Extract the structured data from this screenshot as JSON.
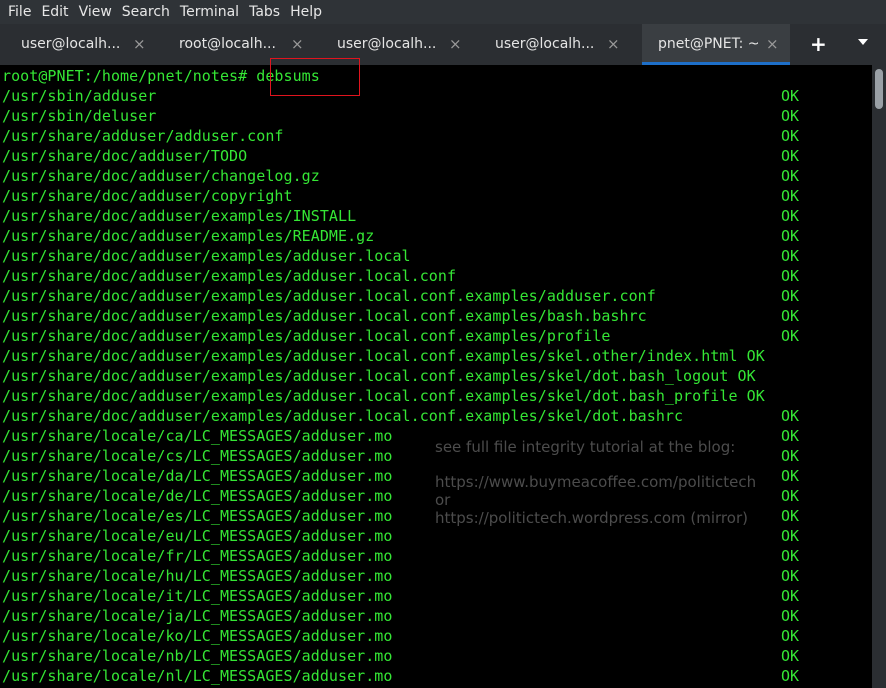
{
  "menu": [
    "File",
    "Edit",
    "View",
    "Search",
    "Terminal",
    "Tabs",
    "Help"
  ],
  "tabs": [
    {
      "label": "user@localh...",
      "close": "×"
    },
    {
      "label": "root@localh...",
      "close": "×"
    },
    {
      "label": "user@localh...",
      "close": "×"
    },
    {
      "label": "user@localh...",
      "close": "×"
    },
    {
      "label": "pnet@PNET: ~",
      "close": "×",
      "active": true
    }
  ],
  "add_tab": "+",
  "prompt": {
    "text": "root@PNET:/home/pnet/notes# ",
    "command": "debsums"
  },
  "lines": [
    {
      "path": "/usr/sbin/adduser",
      "status": "OK"
    },
    {
      "path": "/usr/sbin/deluser",
      "status": "OK"
    },
    {
      "path": "/usr/share/adduser/adduser.conf",
      "status": "OK"
    },
    {
      "path": "/usr/share/doc/adduser/TODO",
      "status": "OK"
    },
    {
      "path": "/usr/share/doc/adduser/changelog.gz",
      "status": "OK"
    },
    {
      "path": "/usr/share/doc/adduser/copyright",
      "status": "OK"
    },
    {
      "path": "/usr/share/doc/adduser/examples/INSTALL",
      "status": "OK"
    },
    {
      "path": "/usr/share/doc/adduser/examples/README.gz",
      "status": "OK"
    },
    {
      "path": "/usr/share/doc/adduser/examples/adduser.local",
      "status": "OK"
    },
    {
      "path": "/usr/share/doc/adduser/examples/adduser.local.conf",
      "status": "OK"
    },
    {
      "path": "/usr/share/doc/adduser/examples/adduser.local.conf.examples/adduser.conf",
      "status": "OK"
    },
    {
      "path": "/usr/share/doc/adduser/examples/adduser.local.conf.examples/bash.bashrc",
      "status": "OK"
    },
    {
      "path": "/usr/share/doc/adduser/examples/adduser.local.conf.examples/profile",
      "status": "OK"
    },
    {
      "path": "/usr/share/doc/adduser/examples/adduser.local.conf.examples/skel.other/index.html OK",
      "status": ""
    },
    {
      "path": "/usr/share/doc/adduser/examples/adduser.local.conf.examples/skel/dot.bash_logout OK",
      "status": ""
    },
    {
      "path": "/usr/share/doc/adduser/examples/adduser.local.conf.examples/skel/dot.bash_profile OK",
      "status": ""
    },
    {
      "path": "/usr/share/doc/adduser/examples/adduser.local.conf.examples/skel/dot.bashrc",
      "status": "OK"
    },
    {
      "path": "/usr/share/locale/ca/LC_MESSAGES/adduser.mo",
      "status": "OK"
    },
    {
      "path": "/usr/share/locale/cs/LC_MESSAGES/adduser.mo",
      "status": "OK"
    },
    {
      "path": "/usr/share/locale/da/LC_MESSAGES/adduser.mo",
      "status": "OK"
    },
    {
      "path": "/usr/share/locale/de/LC_MESSAGES/adduser.mo",
      "status": "OK"
    },
    {
      "path": "/usr/share/locale/es/LC_MESSAGES/adduser.mo",
      "status": "OK"
    },
    {
      "path": "/usr/share/locale/eu/LC_MESSAGES/adduser.mo",
      "status": "OK"
    },
    {
      "path": "/usr/share/locale/fr/LC_MESSAGES/adduser.mo",
      "status": "OK"
    },
    {
      "path": "/usr/share/locale/hu/LC_MESSAGES/adduser.mo",
      "status": "OK"
    },
    {
      "path": "/usr/share/locale/it/LC_MESSAGES/adduser.mo",
      "status": "OK"
    },
    {
      "path": "/usr/share/locale/ja/LC_MESSAGES/adduser.mo",
      "status": "OK"
    },
    {
      "path": "/usr/share/locale/ko/LC_MESSAGES/adduser.mo",
      "status": "OK"
    },
    {
      "path": "/usr/share/locale/nb/LC_MESSAGES/adduser.mo",
      "status": "OK"
    },
    {
      "path": "/usr/share/locale/nl/LC_MESSAGES/adduser.mo",
      "status": "OK"
    }
  ],
  "watermark": [
    "see full file integrity tutorial at the blog:",
    "https://www.buymeacoffee.com/politictech",
    "or",
    "https://politictech.wordpress.com (mirror)"
  ],
  "colors": {
    "terminal_text": "#35e635",
    "highlight_box": "#e0141e",
    "active_tab_indicator": "#1e6fc8"
  }
}
